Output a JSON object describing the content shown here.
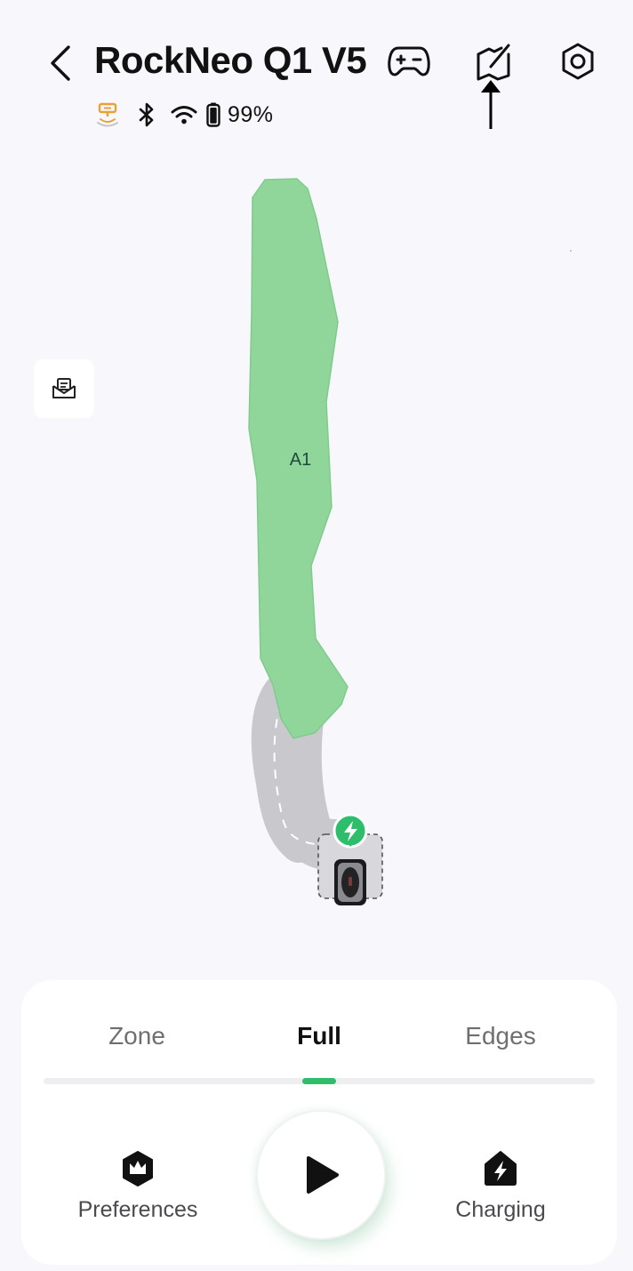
{
  "header": {
    "title": "RockNeo Q1 V5",
    "icons": {
      "back": "chevron-left-icon",
      "gamepad": "gamepad-icon",
      "map_edit": "map-edit-icon",
      "settings": "gear-icon"
    }
  },
  "status": {
    "battery_text": "99%",
    "icons": [
      "base-station-icon",
      "bluetooth-icon",
      "wifi-icon",
      "battery-icon"
    ],
    "base_station_color": "#e8a13a"
  },
  "map": {
    "zone_label": "A1",
    "zone_color": "#90d69b",
    "path_color": "#c9c8cc",
    "charging_badge_color": "#2ebd6b"
  },
  "mode_tabs": {
    "items": [
      {
        "label": "Zone",
        "selected": false
      },
      {
        "label": "Full",
        "selected": true
      },
      {
        "label": "Edges",
        "selected": false
      }
    ],
    "accent_color": "#2ebd6b"
  },
  "actions": {
    "preferences_label": "Preferences",
    "charging_label": "Charging",
    "play_icon": "play-icon"
  }
}
